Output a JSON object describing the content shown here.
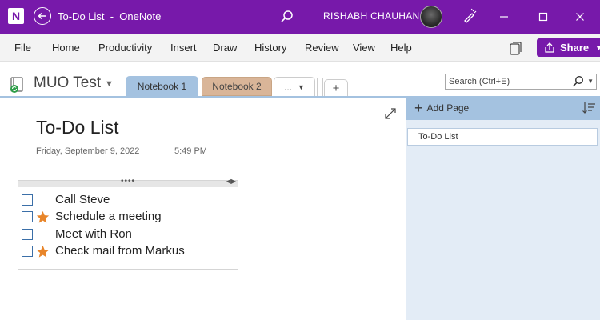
{
  "titlebar": {
    "app_icon_letter": "N",
    "window_title": "To-Do List  -  OneNote",
    "user_name": "RISHABH CHAUHAN",
    "icons": [
      "onenote-icon",
      "back-icon",
      "search-icon",
      "avatar",
      "pen-icon",
      "minimize-icon",
      "maximize-icon",
      "close-icon"
    ]
  },
  "menu": {
    "items": [
      "File",
      "Home",
      "Productivity",
      "Insert",
      "Draw",
      "History",
      "Review",
      "View",
      "Help"
    ],
    "share_label": "Share"
  },
  "notebook": {
    "name": "MUO Test",
    "sections": [
      {
        "label": "Notebook 1",
        "active": true,
        "color": "#a4c2e0"
      },
      {
        "label": "Notebook 2",
        "active": false,
        "color": "#d9b598"
      }
    ],
    "more_label": "...",
    "add_label": "+"
  },
  "search": {
    "placeholder": "Search (Ctrl+E)"
  },
  "page": {
    "title": "To-Do List",
    "date": "Friday, September 9, 2022",
    "time": "5:49 PM",
    "todos": [
      {
        "text": "Call Steve",
        "starred": false,
        "checked": false
      },
      {
        "text": "Schedule a meeting",
        "starred": true,
        "checked": false
      },
      {
        "text": "Meet with Ron",
        "starred": false,
        "checked": false
      },
      {
        "text": "Check mail from Markus",
        "starred": true,
        "checked": false
      }
    ]
  },
  "pages_pane": {
    "add_page_label": "Add Page",
    "pages": [
      "To-Do List"
    ]
  },
  "colors": {
    "brand": "#7719aa",
    "section_active": "#a4c2e0",
    "star": "#e8852a",
    "pane_bg": "#e3ecf6"
  }
}
